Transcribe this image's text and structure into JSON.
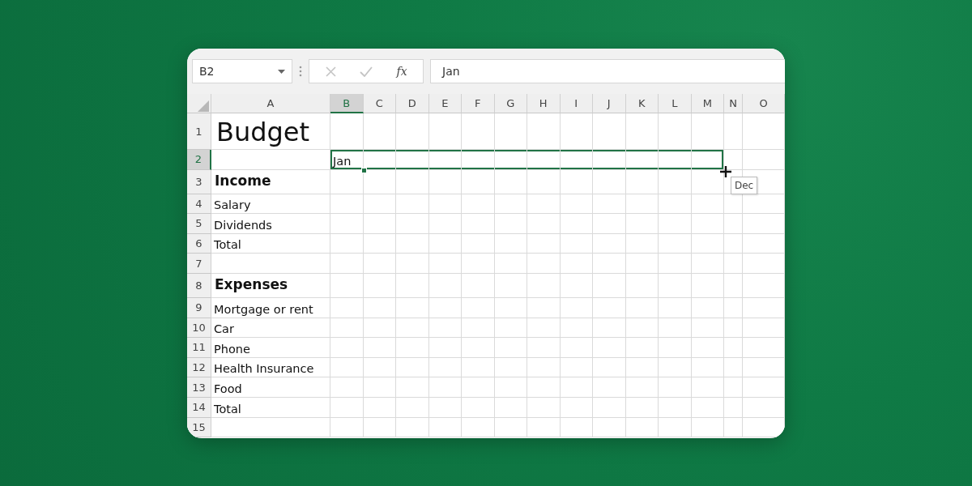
{
  "formula_bar": {
    "name_box": "B2",
    "buttons": [
      {
        "kind": "cancel",
        "disabled": true
      },
      {
        "kind": "enter",
        "disabled": true
      },
      {
        "kind": "function",
        "label": "fx",
        "disabled": false
      }
    ],
    "formula": "Jan"
  },
  "sheet": {
    "columns": [
      {
        "label": "A",
        "selected": false,
        "in_range": false
      },
      {
        "label": "B",
        "selected": true,
        "in_range": true
      },
      {
        "label": "C",
        "selected": false,
        "in_range": true
      },
      {
        "label": "D",
        "selected": false,
        "in_range": true
      },
      {
        "label": "E",
        "selected": false,
        "in_range": true
      },
      {
        "label": "F",
        "selected": false,
        "in_range": true
      },
      {
        "label": "G",
        "selected": false,
        "in_range": true
      },
      {
        "label": "H",
        "selected": false,
        "in_range": true
      },
      {
        "label": "I",
        "selected": false,
        "in_range": true
      },
      {
        "label": "J",
        "selected": false,
        "in_range": true
      },
      {
        "label": "K",
        "selected": false,
        "in_range": true
      },
      {
        "label": "L",
        "selected": false,
        "in_range": true
      },
      {
        "label": "M",
        "selected": false,
        "in_range": true
      },
      {
        "label": "N",
        "selected": false,
        "in_range": false
      },
      {
        "label": "O",
        "selected": false,
        "in_range": false
      }
    ],
    "rows": [
      {
        "label": "1",
        "selected": false,
        "kind": "title",
        "cells": [
          "Budget",
          ""
        ]
      },
      {
        "label": "2",
        "selected": true,
        "kind": "text",
        "cells": [
          "",
          "Jan"
        ]
      },
      {
        "label": "3",
        "selected": false,
        "kind": "heading",
        "cells": [
          "Income",
          ""
        ]
      },
      {
        "label": "4",
        "selected": false,
        "kind": "text",
        "cells": [
          "Salary",
          ""
        ]
      },
      {
        "label": "5",
        "selected": false,
        "kind": "text",
        "cells": [
          "Dividends",
          ""
        ]
      },
      {
        "label": "6",
        "selected": false,
        "kind": "text",
        "cells": [
          "Total",
          ""
        ]
      },
      {
        "label": "7",
        "selected": false,
        "kind": "text",
        "cells": [
          "",
          ""
        ]
      },
      {
        "label": "8",
        "selected": false,
        "kind": "heading",
        "cells": [
          "Expenses",
          ""
        ]
      },
      {
        "label": "9",
        "selected": false,
        "kind": "text",
        "cells": [
          "Mortgage or rent",
          ""
        ]
      },
      {
        "label": "10",
        "selected": false,
        "kind": "text",
        "cells": [
          "Car",
          ""
        ]
      },
      {
        "label": "11",
        "selected": false,
        "kind": "text",
        "cells": [
          "Phone",
          ""
        ]
      },
      {
        "label": "12",
        "selected": false,
        "kind": "text",
        "cells": [
          "Health Insurance",
          ""
        ]
      },
      {
        "label": "13",
        "selected": false,
        "kind": "text",
        "cells": [
          "Food",
          ""
        ]
      },
      {
        "label": "14",
        "selected": false,
        "kind": "text",
        "cells": [
          "Total",
          ""
        ]
      },
      {
        "label": "15",
        "selected": false,
        "kind": "text",
        "cells": [
          "",
          ""
        ]
      }
    ],
    "fill_tooltip": "Dec"
  }
}
